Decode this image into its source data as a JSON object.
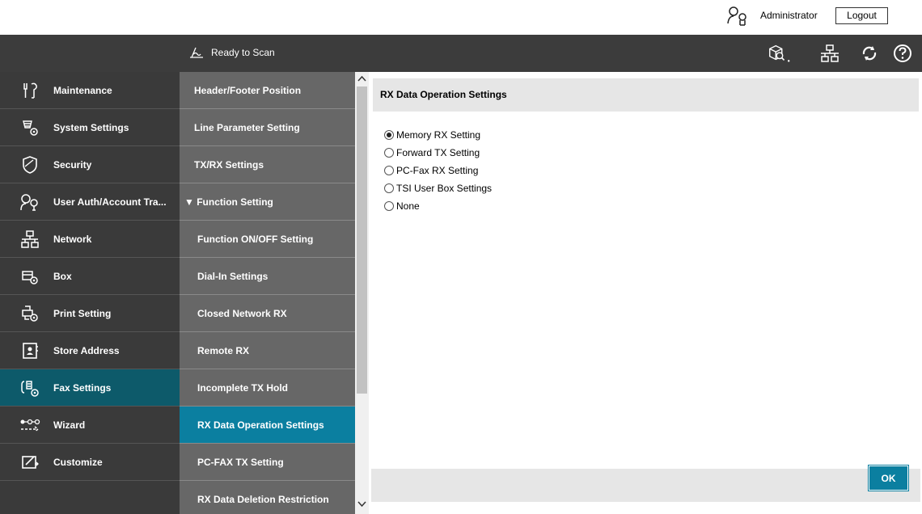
{
  "topbar": {
    "user_name": "Administrator",
    "logout_label": "Logout",
    "user_icon": "user-admin-icon"
  },
  "header": {
    "status_text": "Ready to Scan",
    "status_icon": "scanner-icon",
    "icons": [
      "search-box-icon",
      "network-icon",
      "refresh-icon",
      "help-icon"
    ]
  },
  "leftnav": {
    "items": [
      {
        "label": "Maintenance",
        "icon": "maintenance-icon"
      },
      {
        "label": "System Settings",
        "icon": "system-settings-icon"
      },
      {
        "label": "Security",
        "icon": "security-shield-icon"
      },
      {
        "label": "User Auth/Account Tra...",
        "icon": "user-auth-icon"
      },
      {
        "label": "Network",
        "icon": "network-icon"
      },
      {
        "label": "Box",
        "icon": "box-icon"
      },
      {
        "label": "Print Setting",
        "icon": "print-setting-icon"
      },
      {
        "label": "Store Address",
        "icon": "store-address-icon"
      },
      {
        "label": "Fax Settings",
        "icon": "fax-settings-icon"
      },
      {
        "label": "Wizard",
        "icon": "wizard-icon"
      },
      {
        "label": "Customize",
        "icon": "customize-icon"
      }
    ],
    "active": "Fax Settings"
  },
  "subnav": {
    "items": [
      "Header/Footer Position",
      "Line Parameter Setting",
      "TX/RX Settings",
      "▼ Function Setting",
      "Function ON/OFF Setting",
      "Dial-In Settings",
      "Closed Network RX",
      "Remote RX",
      "Incomplete TX Hold",
      "RX Data Operation Settings",
      "PC-FAX TX Setting",
      "RX Data Deletion Restriction"
    ],
    "selected": "RX Data Operation Settings"
  },
  "main": {
    "title": "RX Data Operation Settings",
    "options": [
      {
        "label": "Memory RX Setting",
        "checked": true
      },
      {
        "label": "Forward TX Setting",
        "checked": false
      },
      {
        "label": "PC-Fax RX Setting",
        "checked": false
      },
      {
        "label": "TSI User Box Settings",
        "checked": false
      },
      {
        "label": "None",
        "checked": false
      }
    ],
    "ok_label": "OK"
  },
  "colors": {
    "header_bg": "#3c3c3c",
    "leftnav_bg": "#3a3a3a",
    "active_nav": "#0d5a6a",
    "subnav_bg": "#676767",
    "selected_sub": "#0b7fa0",
    "panel_bg": "#e6e6e6"
  }
}
